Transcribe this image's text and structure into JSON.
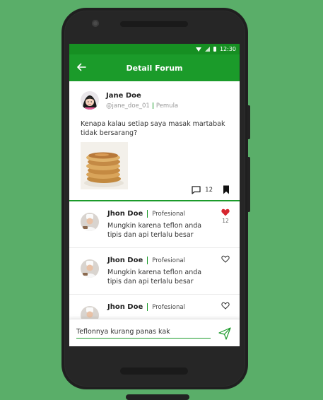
{
  "status_bar": {
    "time": "12:30"
  },
  "app_bar": {
    "title": "Detail Forum",
    "back_icon": "arrow-left-icon"
  },
  "post": {
    "author_name": "Jane Doe",
    "author_handle": "@jane_doe_01",
    "author_level": "Pemula",
    "question": "Kenapa kalau setiap saya masak martabak tidak bersarang?",
    "comment_count": "12",
    "icons": {
      "comment": "comment-icon",
      "bookmark": "bookmark-icon"
    }
  },
  "comments": [
    {
      "name": "Jhon Doe",
      "level": "Profesional",
      "text": "Mungkin karena teflon anda tipis dan api terlalu besar",
      "liked": true,
      "like_count": "12"
    },
    {
      "name": "Jhon Doe",
      "level": "Profesional",
      "text": "Mungkin karena teflon anda tipis dan api terlalu besar",
      "liked": false,
      "like_count": ""
    },
    {
      "name": "Jhon Doe",
      "level": "Profesional",
      "text": "",
      "liked": false,
      "like_count": ""
    }
  ],
  "reply": {
    "value": "Teflonnya kurang panas kak"
  },
  "colors": {
    "primary": "#1b9b2a",
    "heart": "#d6262f",
    "background": "#5aae69"
  }
}
